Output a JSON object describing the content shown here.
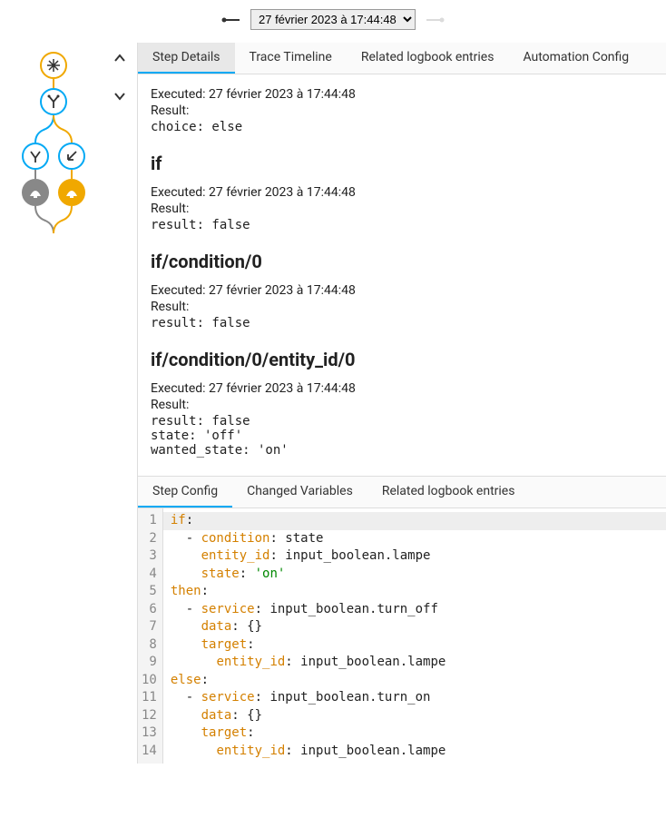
{
  "topbar": {
    "trace_selected": "27 février 2023 à 17:44:48"
  },
  "tabs": {
    "step_details": "Step Details",
    "trace_timeline": "Trace Timeline",
    "related_logbook": "Related logbook entries",
    "automation_config": "Automation Config"
  },
  "blocks": {
    "root": {
      "executed": "Executed: 27 février 2023 à 17:44:48",
      "result_label": "Result:",
      "result_code": "choice: else"
    },
    "if": {
      "heading": "if",
      "executed": "Executed: 27 février 2023 à 17:44:48",
      "result_label": "Result:",
      "result_code": "result: false"
    },
    "cond0": {
      "heading": "if/condition/0",
      "executed": "Executed: 27 février 2023 à 17:44:48",
      "result_label": "Result:",
      "result_code": "result: false"
    },
    "entity0": {
      "heading": "if/condition/0/entity_id/0",
      "executed": "Executed: 27 février 2023 à 17:44:48",
      "result_label": "Result:",
      "result_code": "result: false\nstate: 'off'\nwanted_state: 'on'"
    }
  },
  "subtabs": {
    "step_config": "Step Config",
    "changed_vars": "Changed Variables",
    "related_logbook": "Related logbook entries"
  },
  "code": {
    "line_numbers": [
      "1",
      "2",
      "3",
      "4",
      "5",
      "6",
      "7",
      "8",
      "9",
      "10",
      "11",
      "12",
      "13",
      "14"
    ],
    "l1_key": "if",
    "l2_dash": "  - ",
    "l2_key": "condition",
    "l2_val": "state",
    "l3_pad": "    ",
    "l3_key": "entity_id",
    "l3_val": "input_boolean.lampe",
    "l4_pad": "    ",
    "l4_key": "state",
    "l4_val": "'on'",
    "l5_key": "then",
    "l6_dash": "  - ",
    "l6_key": "service",
    "l6_val": "input_boolean.turn_off",
    "l7_pad": "    ",
    "l7_key": "data",
    "l7_val": "{}",
    "l8_pad": "    ",
    "l8_key": "target",
    "l9_pad": "      ",
    "l9_key": "entity_id",
    "l9_val": "input_boolean.lampe",
    "l10_key": "else",
    "l11_dash": "  - ",
    "l11_key": "service",
    "l11_val": "input_boolean.turn_on",
    "l12_pad": "    ",
    "l12_key": "data",
    "l12_val": "{}",
    "l13_pad": "    ",
    "l13_key": "target",
    "l14_pad": "      ",
    "l14_key": "entity_id",
    "l14_val": "input_boolean.lampe"
  }
}
